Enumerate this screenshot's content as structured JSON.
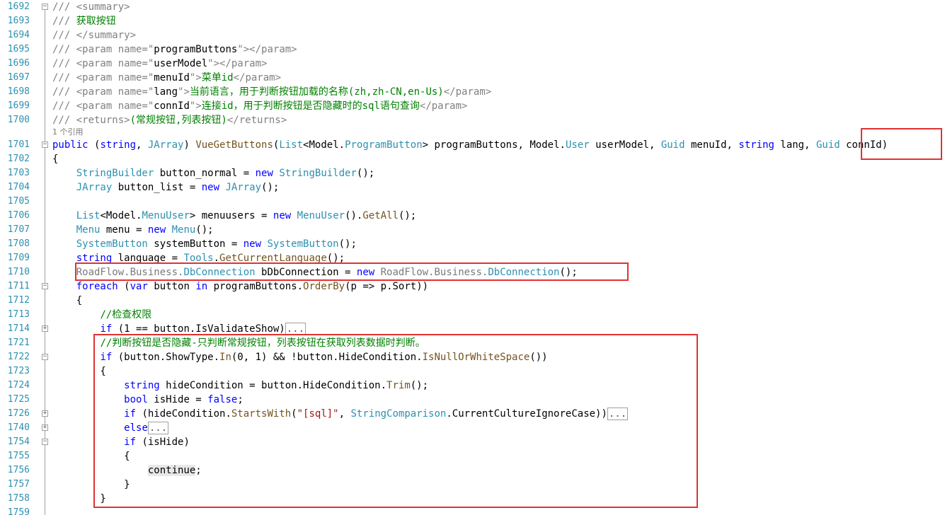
{
  "editor": {
    "reference_hint": "1 个引用",
    "lines": [
      {
        "num": "1692",
        "fold": "minus",
        "tokens": [
          [
            "xml",
            "/// <summary>"
          ]
        ]
      },
      {
        "num": "1693",
        "tokens": [
          [
            "xml",
            "/// "
          ],
          [
            "com",
            "获取按钮"
          ]
        ]
      },
      {
        "num": "1694",
        "tokens": [
          [
            "xml",
            "/// </summary>"
          ]
        ]
      },
      {
        "num": "1695",
        "tokens": [
          [
            "xml",
            "/// <param name=\""
          ],
          [
            "plain",
            "programButtons"
          ],
          [
            "xml",
            "\"></param>"
          ]
        ]
      },
      {
        "num": "1696",
        "tokens": [
          [
            "xml",
            "/// <param name=\""
          ],
          [
            "plain",
            "userModel"
          ],
          [
            "xml",
            "\"></param>"
          ]
        ]
      },
      {
        "num": "1697",
        "tokens": [
          [
            "xml",
            "/// <param name=\""
          ],
          [
            "plain",
            "menuId"
          ],
          [
            "xml",
            "\">"
          ],
          [
            "com",
            "菜单id"
          ],
          [
            "xml",
            "</param>"
          ]
        ]
      },
      {
        "num": "1698",
        "tokens": [
          [
            "xml",
            "/// <param name=\""
          ],
          [
            "plain",
            "lang"
          ],
          [
            "xml",
            "\">"
          ],
          [
            "com",
            "当前语言，用于判断按钮加载的名称(zh,zh-CN,en-Us)"
          ],
          [
            "xml",
            "</param>"
          ]
        ]
      },
      {
        "num": "1699",
        "tokens": [
          [
            "xml",
            "/// <param name=\""
          ],
          [
            "plain",
            "connId"
          ],
          [
            "xml",
            "\">"
          ],
          [
            "com",
            "连接id，用于判断按钮是否隐藏时的sql语句查询"
          ],
          [
            "xml",
            "</param>"
          ]
        ]
      },
      {
        "num": "1700",
        "tokens": [
          [
            "xml",
            "/// <returns>"
          ],
          [
            "com",
            "(常规按钮,列表按钮)"
          ],
          [
            "xml",
            "</returns>"
          ]
        ]
      },
      {
        "num": "1701",
        "fold": "minus",
        "tokens": [
          [
            "kw",
            "public"
          ],
          [
            "plain",
            " ("
          ],
          [
            "kw",
            "string"
          ],
          [
            "plain",
            ", "
          ],
          [
            "ty",
            "JArray"
          ],
          [
            "plain",
            ") "
          ],
          [
            "mth",
            "VueGetButtons"
          ],
          [
            "plain",
            "("
          ],
          [
            "ty",
            "List"
          ],
          [
            "plain",
            "<Model."
          ],
          [
            "ty",
            "ProgramButton"
          ],
          [
            "plain",
            "> programButtons, Model."
          ],
          [
            "ty",
            "User"
          ],
          [
            "plain",
            " userModel, "
          ],
          [
            "ty",
            "Guid"
          ],
          [
            "plain",
            " menuId, "
          ],
          [
            "kw",
            "string"
          ],
          [
            "plain",
            " lang, "
          ],
          [
            "ty",
            "Guid"
          ],
          [
            "plain",
            " connId)"
          ]
        ]
      },
      {
        "num": "1702",
        "tokens": [
          [
            "plain",
            "{"
          ]
        ]
      },
      {
        "num": "1703",
        "tokens": [
          [
            "plain",
            "    "
          ],
          [
            "ty",
            "StringBuilder"
          ],
          [
            "plain",
            " button_normal = "
          ],
          [
            "kw",
            "new"
          ],
          [
            "plain",
            " "
          ],
          [
            "ty",
            "StringBuilder"
          ],
          [
            "plain",
            "();"
          ]
        ]
      },
      {
        "num": "1704",
        "tokens": [
          [
            "plain",
            "    "
          ],
          [
            "ty",
            "JArray"
          ],
          [
            "plain",
            " button_list = "
          ],
          [
            "kw",
            "new"
          ],
          [
            "plain",
            " "
          ],
          [
            "ty",
            "JArray"
          ],
          [
            "plain",
            "();"
          ]
        ]
      },
      {
        "num": "1705",
        "tokens": []
      },
      {
        "num": "1706",
        "tokens": [
          [
            "plain",
            "    "
          ],
          [
            "ty",
            "List"
          ],
          [
            "plain",
            "<Model."
          ],
          [
            "ty",
            "MenuUser"
          ],
          [
            "plain",
            "> menuusers = "
          ],
          [
            "kw",
            "new"
          ],
          [
            "plain",
            " "
          ],
          [
            "ty",
            "MenuUser"
          ],
          [
            "plain",
            "()."
          ],
          [
            "mth",
            "GetAll"
          ],
          [
            "plain",
            "();"
          ]
        ]
      },
      {
        "num": "1707",
        "tokens": [
          [
            "plain",
            "    "
          ],
          [
            "ty",
            "Menu"
          ],
          [
            "plain",
            " menu = "
          ],
          [
            "kw",
            "new"
          ],
          [
            "plain",
            " "
          ],
          [
            "ty",
            "Menu"
          ],
          [
            "plain",
            "();"
          ]
        ]
      },
      {
        "num": "1708",
        "tokens": [
          [
            "plain",
            "    "
          ],
          [
            "ty",
            "SystemButton"
          ],
          [
            "plain",
            " systemButton = "
          ],
          [
            "kw",
            "new"
          ],
          [
            "plain",
            " "
          ],
          [
            "ty",
            "SystemButton"
          ],
          [
            "plain",
            "();"
          ]
        ]
      },
      {
        "num": "1709",
        "tokens": [
          [
            "plain",
            "    "
          ],
          [
            "kw",
            "string"
          ],
          [
            "plain",
            " language = "
          ],
          [
            "ty",
            "Tools"
          ],
          [
            "plain",
            "."
          ],
          [
            "mth",
            "GetCurrentLanguage"
          ],
          [
            "plain",
            "();"
          ]
        ]
      },
      {
        "num": "1710",
        "tokens": [
          [
            "plain",
            "    "
          ],
          [
            "ns",
            "RoadFlow.Business."
          ],
          [
            "ty",
            "DbConnection"
          ],
          [
            "plain",
            " bDbConnection = "
          ],
          [
            "kw",
            "new"
          ],
          [
            "plain",
            " "
          ],
          [
            "ns",
            "RoadFlow.Business."
          ],
          [
            "ty",
            "DbConnection"
          ],
          [
            "plain",
            "();"
          ]
        ]
      },
      {
        "num": "1711",
        "fold": "minus",
        "tokens": [
          [
            "plain",
            "    "
          ],
          [
            "kw",
            "foreach"
          ],
          [
            "plain",
            " ("
          ],
          [
            "kw",
            "var"
          ],
          [
            "plain",
            " button "
          ],
          [
            "kw",
            "in"
          ],
          [
            "plain",
            " programButtons."
          ],
          [
            "mth",
            "OrderBy"
          ],
          [
            "plain",
            "(p => p.Sort))"
          ]
        ]
      },
      {
        "num": "1712",
        "tokens": [
          [
            "plain",
            "    {"
          ]
        ]
      },
      {
        "num": "1713",
        "tokens": [
          [
            "plain",
            "        "
          ],
          [
            "com",
            "//检查权限"
          ]
        ]
      },
      {
        "num": "1714",
        "fold": "plus",
        "tokens": [
          [
            "plain",
            "        "
          ],
          [
            "kw",
            "if"
          ],
          [
            "plain",
            " (1 == button.IsValidateShow)"
          ],
          [
            "col",
            "..."
          ]
        ]
      },
      {
        "num": "1721",
        "tokens": [
          [
            "plain",
            "        "
          ],
          [
            "com",
            "//判断按钮是否隐藏-只判断常规按钮，列表按钮在获取列表数据时判断。"
          ]
        ]
      },
      {
        "num": "1722",
        "fold": "minus",
        "tokens": [
          [
            "plain",
            "        "
          ],
          [
            "kw",
            "if"
          ],
          [
            "plain",
            " (button.ShowType."
          ],
          [
            "mth",
            "In"
          ],
          [
            "plain",
            "(0, 1) && !button.HideCondition."
          ],
          [
            "mth",
            "IsNullOrWhiteSpace"
          ],
          [
            "plain",
            "())"
          ]
        ]
      },
      {
        "num": "1723",
        "tokens": [
          [
            "plain",
            "        {"
          ]
        ]
      },
      {
        "num": "1724",
        "tokens": [
          [
            "plain",
            "            "
          ],
          [
            "kw",
            "string"
          ],
          [
            "plain",
            " hideCondition = button.HideCondition."
          ],
          [
            "mth",
            "Trim"
          ],
          [
            "plain",
            "();"
          ]
        ]
      },
      {
        "num": "1725",
        "tokens": [
          [
            "plain",
            "            "
          ],
          [
            "kw",
            "bool"
          ],
          [
            "plain",
            " isHide = "
          ],
          [
            "kw",
            "false"
          ],
          [
            "plain",
            ";"
          ]
        ]
      },
      {
        "num": "1726",
        "fold": "plus",
        "tokens": [
          [
            "plain",
            "            "
          ],
          [
            "kw",
            "if"
          ],
          [
            "plain",
            " (hideCondition."
          ],
          [
            "mth",
            "StartsWith"
          ],
          [
            "plain",
            "("
          ],
          [
            "str",
            "\"[sql]\""
          ],
          [
            "plain",
            ", "
          ],
          [
            "ty",
            "StringComparison"
          ],
          [
            "plain",
            ".CurrentCultureIgnoreCase))"
          ],
          [
            "col",
            "..."
          ]
        ]
      },
      {
        "num": "1740",
        "fold": "plus",
        "tokens": [
          [
            "plain",
            "            "
          ],
          [
            "kw",
            "else"
          ],
          [
            "col",
            "..."
          ]
        ]
      },
      {
        "num": "1754",
        "fold": "minus",
        "tokens": [
          [
            "plain",
            "            "
          ],
          [
            "kw",
            "if"
          ],
          [
            "plain",
            " (isHide)"
          ]
        ]
      },
      {
        "num": "1755",
        "tokens": [
          [
            "plain",
            "            {"
          ]
        ]
      },
      {
        "num": "1756",
        "tokens": [
          [
            "plain",
            "                "
          ],
          [
            "cont",
            "continue"
          ],
          [
            "plain",
            ";"
          ]
        ]
      },
      {
        "num": "1757",
        "tokens": [
          [
            "plain",
            "            }"
          ]
        ]
      },
      {
        "num": "1758",
        "tokens": [
          [
            "plain",
            "        }"
          ]
        ]
      },
      {
        "num": "1759",
        "tokens": []
      }
    ]
  },
  "highlight_color": "#e03232"
}
